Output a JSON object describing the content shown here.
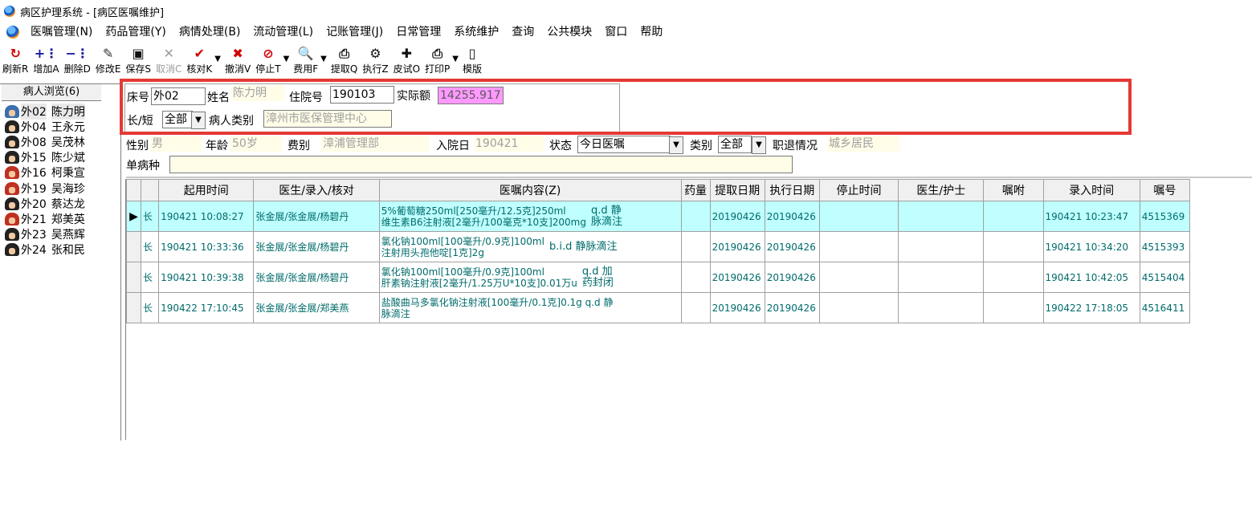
{
  "window": {
    "title": "病区护理系统 - [病区医嘱维护]"
  },
  "menu": [
    "医嘱管理(N)",
    "药品管理(Y)",
    "病情处理(B)",
    "流动管理(L)",
    "记账管理(J)",
    "日常管理",
    "系统维护",
    "查询",
    "公共模块",
    "窗口",
    "帮助"
  ],
  "toolbar": [
    {
      "label": "刷新R",
      "icon": "refresh-icon",
      "glyph": "↻",
      "color": "#d00000",
      "enabled": true,
      "dropdown": false
    },
    {
      "label": "增加A",
      "icon": "add-row-icon",
      "glyph": "+⋮",
      "color": "#1a1aa0",
      "enabled": true,
      "dropdown": false
    },
    {
      "label": "删除D",
      "icon": "delete-row-icon",
      "glyph": "−⋮",
      "color": "#1a1aa0",
      "enabled": true,
      "dropdown": false
    },
    {
      "label": "修改E",
      "icon": "edit-icon",
      "glyph": "✎",
      "color": "#333333",
      "enabled": true,
      "dropdown": false
    },
    {
      "label": "保存S",
      "icon": "save-icon",
      "glyph": "▣",
      "color": "#111111",
      "enabled": true,
      "dropdown": false
    },
    {
      "label": "取消C",
      "icon": "cancel-icon",
      "glyph": "✕",
      "color": "#9a9a9a",
      "enabled": false,
      "dropdown": false
    },
    {
      "label": "核对K",
      "icon": "check-icon",
      "glyph": "✔",
      "color": "#d00000",
      "enabled": true,
      "dropdown": true
    },
    {
      "label": "撤消V",
      "icon": "revoke-icon",
      "glyph": "✖",
      "color": "#d00000",
      "enabled": true,
      "dropdown": false
    },
    {
      "label": "停止T",
      "icon": "stop-icon",
      "glyph": "⊘",
      "color": "#d00000",
      "enabled": true,
      "dropdown": true
    },
    {
      "label": "费用F",
      "icon": "fee-search-icon",
      "glyph": "🔍",
      "color": "#111111",
      "enabled": true,
      "dropdown": true
    },
    {
      "label": "提取Q",
      "icon": "extract-print-icon",
      "glyph": "⎙",
      "color": "#111111",
      "enabled": true,
      "dropdown": false
    },
    {
      "label": "执行Z",
      "icon": "execute-icon",
      "glyph": "⚙",
      "color": "#111111",
      "enabled": true,
      "dropdown": false
    },
    {
      "label": "皮试O",
      "icon": "skin-test-icon",
      "glyph": "✚",
      "color": "#111111",
      "enabled": true,
      "dropdown": false
    },
    {
      "label": "打印P",
      "icon": "printer-icon",
      "glyph": "⎙",
      "color": "#111111",
      "enabled": true,
      "dropdown": true
    },
    {
      "label": "模版",
      "icon": "template-door-icon",
      "glyph": "▯",
      "color": "#111111",
      "enabled": true,
      "dropdown": false
    }
  ],
  "sidebar": {
    "header": "病人浏览(6)",
    "patients": [
      {
        "bed": "外02",
        "name": "陈力明",
        "avatar_color": "#3a6fb0",
        "selected": true
      },
      {
        "bed": "外04",
        "name": "王永元",
        "avatar_color": "#222222",
        "selected": false
      },
      {
        "bed": "外08",
        "name": "吴茂林",
        "avatar_color": "#222222",
        "selected": false
      },
      {
        "bed": "外15",
        "name": "陈少斌",
        "avatar_color": "#222222",
        "selected": false
      },
      {
        "bed": "外16",
        "name": "柯秉宣",
        "avatar_color": "#c03020",
        "selected": false
      },
      {
        "bed": "外19",
        "name": "吴海珍",
        "avatar_color": "#c03020",
        "selected": false
      },
      {
        "bed": "外20",
        "name": "蔡达龙",
        "avatar_color": "#222222",
        "selected": false
      },
      {
        "bed": "外21",
        "name": "郑美英",
        "avatar_color": "#c03020",
        "selected": false
      },
      {
        "bed": "外23",
        "name": "吴燕辉",
        "avatar_color": "#222222",
        "selected": false
      },
      {
        "bed": "外24",
        "name": "张和民",
        "avatar_color": "#222222",
        "selected": false
      }
    ]
  },
  "patient_form": {
    "bed_label": "床号",
    "bed_value": "外02",
    "name_label": "姓名",
    "name_value": "陈力明",
    "admission_no_label": "住院号",
    "admission_no_value": "190103",
    "actual_amount_label": "实际额",
    "actual_amount_value": "14255.917",
    "term_label": "长/短",
    "term_value": "全部",
    "patient_type_label": "病人类别",
    "patient_type_value": "漳州市医保管理中心"
  },
  "patient_info": {
    "gender_label": "性别",
    "gender_value": "男",
    "age_label": "年龄",
    "age_value": "50岁",
    "fee_label": "费别",
    "fee_value": "漳浦管理部",
    "admit_date_label": "入院日",
    "admit_date_value": "190421",
    "status_label": "状态",
    "status_value": "今日医嘱",
    "category_label": "类别",
    "category_value": "全部",
    "occupation_label": "职退情况",
    "occupation_value": "城乡居民",
    "disease_label": "单病种",
    "disease_value": ""
  },
  "orders_table": {
    "columns": [
      "",
      "",
      "起用时间",
      "医生/录入/核对",
      "医嘱内容(Z)",
      "药量",
      "提取日期",
      "执行日期",
      "停止时间",
      "医生/护士",
      "嘱咐",
      "录入时间",
      "嘱号"
    ],
    "rows": [
      {
        "type": "长",
        "start": "190421 10:08:27",
        "doctor": "张金展/张金展/杨碧丹",
        "content_line1": "5%葡萄糖250ml[250毫升/12.5克]250ml",
        "content_line2": "维生素B6注射液[2毫升/100毫克*10支]200mg",
        "freq_line1": "q.d 静",
        "freq_line2": "脉滴注",
        "dose": "",
        "extract_date": "20190426",
        "exec_date": "20190426",
        "stop_time": "",
        "doctor_nurse": "",
        "instruction": "",
        "entry_time": "190421 10:23:47",
        "order_no": "4515369",
        "active": true
      },
      {
        "type": "长",
        "start": "190421 10:33:36",
        "doctor": "张金展/张金展/杨碧丹",
        "content_line1": "氯化钠100ml[100毫升/0.9克]100ml",
        "content_line2": "注射用头孢他啶[1克]2g",
        "freq_line1": "b.i.d 静脉滴注",
        "freq_line2": "",
        "dose": "",
        "extract_date": "20190426",
        "exec_date": "20190426",
        "stop_time": "",
        "doctor_nurse": "",
        "instruction": "",
        "entry_time": "190421 10:34:20",
        "order_no": "4515393",
        "active": false
      },
      {
        "type": "长",
        "start": "190421 10:39:38",
        "doctor": "张金展/张金展/杨碧丹",
        "content_line1": "氯化钠100ml[100毫升/0.9克]100ml",
        "content_line2": "肝素钠注射液[2毫升/1.25万U*10支]0.01万u",
        "freq_line1": "q.d 加",
        "freq_line2": "药封闭",
        "dose": "",
        "extract_date": "20190426",
        "exec_date": "20190426",
        "stop_time": "",
        "doctor_nurse": "",
        "instruction": "",
        "entry_time": "190421 10:42:05",
        "order_no": "4515404",
        "active": false
      },
      {
        "type": "长",
        "start": "190422 17:10:45",
        "doctor": "张金展/张金展/郑美燕",
        "content_line1": "盐酸曲马多氯化钠注射液[100毫升/0.1克]0.1g q.d 静",
        "content_line2": "脉滴注",
        "freq_line1": "",
        "freq_line2": "",
        "dose": "",
        "extract_date": "20190426",
        "exec_date": "20190426",
        "stop_time": "",
        "doctor_nurse": "",
        "instruction": "",
        "entry_time": "190422 17:18:05",
        "order_no": "4516411",
        "active": false
      }
    ]
  },
  "colors": {
    "highlight_border": "#e53935",
    "active_row": "#bfffff",
    "amount_bg": "#ff99ff",
    "order_text": "#006b6b"
  }
}
